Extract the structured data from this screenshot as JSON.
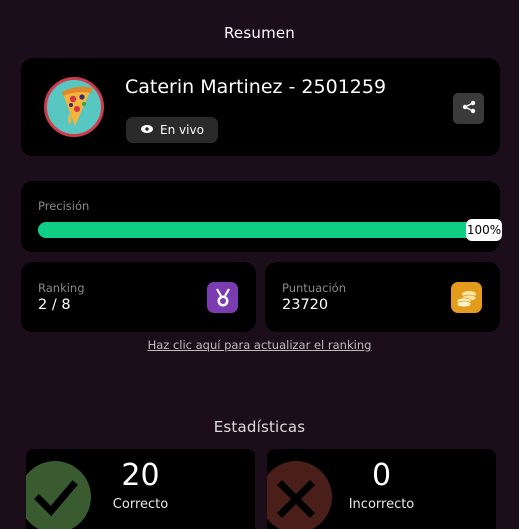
{
  "summary": {
    "title": "Resumen"
  },
  "profile": {
    "name": "Caterin Martinez - 2501259",
    "status_label": "En vivo",
    "avatar_icon": "pizza-icon",
    "share_icon": "share-icon"
  },
  "precision": {
    "label": "Precisión",
    "percent": 100,
    "percent_text": "100%",
    "bar_color": "#0fcf86"
  },
  "ranking": {
    "label": "Ranking",
    "value": "2 / 8",
    "icon": "medal-icon",
    "icon_color": "#7a3cb0"
  },
  "score": {
    "label": "Puntuación",
    "value": "23720",
    "icon": "coins-icon",
    "icon_color": "#e39b1c"
  },
  "refresh_link": "Haz clic aquí para actualizar el ranking",
  "statistics": {
    "title": "Estadísticas",
    "correct": {
      "value": "20",
      "label": "Correcto",
      "icon": "check-icon",
      "color": "#3a5a2f"
    },
    "incorrect": {
      "value": "0",
      "label": "Incorrecto",
      "icon": "x-icon",
      "color": "#4a1f1a"
    }
  }
}
